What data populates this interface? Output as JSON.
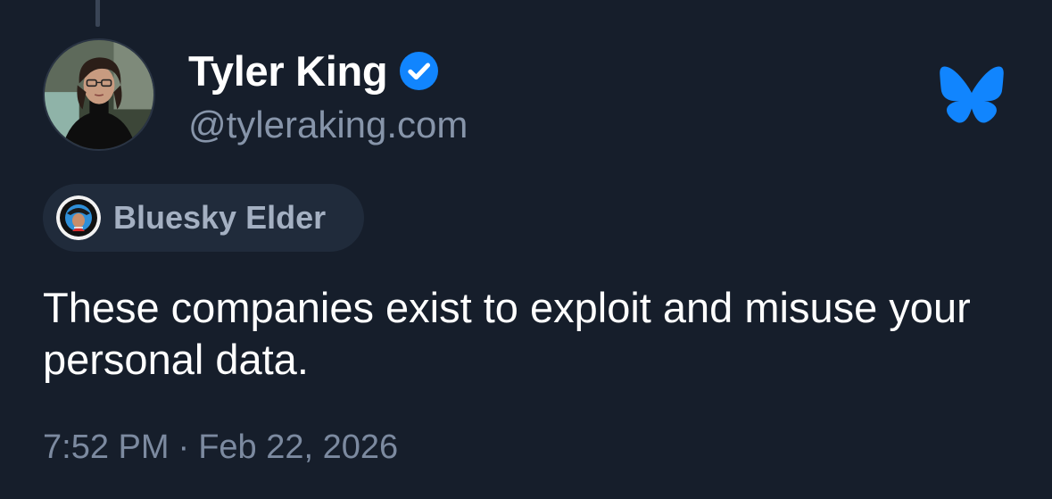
{
  "post": {
    "author": {
      "display_name": "Tyler King",
      "handle": "@tyleraking.com",
      "verified": true,
      "avatar_icon": "user-avatar"
    },
    "badge": {
      "label": "Bluesky Elder",
      "icon": "badge-avatar"
    },
    "text": "These companies exist to exploit and misuse your personal data.",
    "time": "7:52 PM",
    "separator": "·",
    "date": "Feb 22, 2026",
    "platform_icon": "bluesky-butterfly-icon"
  },
  "colors": {
    "background": "#161e2b",
    "brand_blue": "#1185fe",
    "handle_gray": "#8795aa",
    "pill_background": "#202b3b"
  }
}
